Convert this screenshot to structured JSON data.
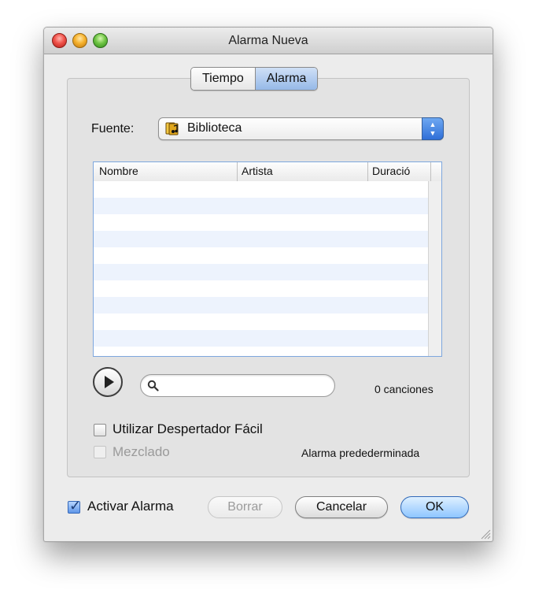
{
  "window": {
    "title": "Alarma Nueva"
  },
  "tabs": {
    "items": [
      {
        "label": "Tiempo"
      },
      {
        "label": "Alarma"
      }
    ]
  },
  "source": {
    "label": "Fuente:",
    "selected": "Biblioteca"
  },
  "table": {
    "columns": [
      "Nombre",
      "Artista",
      "Duració"
    ]
  },
  "search": {
    "value": "",
    "placeholder": ""
  },
  "status": {
    "count_text": "0 canciones",
    "default_alarm": "Alarma predederminada"
  },
  "options": {
    "easy_wake": "Utilizar Despertador Fácil",
    "shuffle": "Mezclado",
    "activate_alarm": "Activar Alarma"
  },
  "buttons": {
    "delete": "Borrar",
    "cancel": "Cancelar",
    "ok": "OK"
  }
}
